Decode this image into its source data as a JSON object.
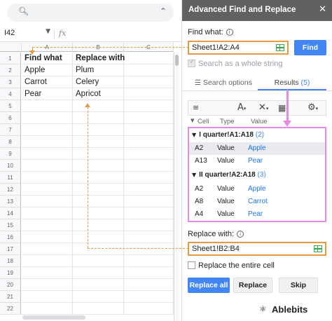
{
  "spreadsheet": {
    "name_box": "I42",
    "fx_label": "fx",
    "columns": [
      "A",
      "B",
      "C"
    ],
    "rows": [
      "1",
      "2",
      "3",
      "4",
      "5",
      "6",
      "7",
      "8",
      "9",
      "10",
      "11",
      "12",
      "13",
      "14",
      "15",
      "16",
      "17",
      "18",
      "19",
      "20",
      "21",
      "22"
    ],
    "cells": [
      [
        "Find what",
        "Replace with"
      ],
      [
        "Apple",
        "Plum"
      ],
      [
        "Carrot",
        "Celery"
      ],
      [
        "Pear",
        "Apricot"
      ]
    ]
  },
  "panel": {
    "title": "Advanced Find and Replace",
    "find_label": "Find what:",
    "find_value": "Sheet1!A2:A4",
    "find_button": "Find",
    "search_whole_label": "Search as a whole string",
    "tabs": [
      {
        "label": "Search options"
      },
      {
        "label": "Results",
        "count": "(5)"
      }
    ],
    "result_columns": [
      "Cell",
      "Type",
      "Value"
    ],
    "groups": [
      {
        "name": "I quarter!A1:A18",
        "count": "(2)",
        "rows": [
          {
            "cell": "A2",
            "type": "Value",
            "value": "Apple"
          },
          {
            "cell": "A13",
            "type": "Value",
            "value": "Pear"
          }
        ]
      },
      {
        "name": "II quarter!A2:A18",
        "count": "(3)",
        "rows": [
          {
            "cell": "A2",
            "type": "Value",
            "value": "Apple"
          },
          {
            "cell": "A8",
            "type": "Value",
            "value": "Carrot"
          },
          {
            "cell": "A4",
            "type": "Value",
            "value": "Pear"
          }
        ]
      }
    ],
    "replace_label": "Replace with:",
    "replace_value": "Sheet1!B2:B4",
    "replace_entire_label": "Replace the entire cell",
    "buttons": {
      "replace_all": "Replace all",
      "replace": "Replace",
      "skip": "Skip"
    },
    "brand": "Ablebits"
  },
  "colors": {
    "accent": "#4285f4",
    "highlight_orange": "#e69b43",
    "highlight_pink": "#e58be5",
    "header_gray": "#616161"
  }
}
